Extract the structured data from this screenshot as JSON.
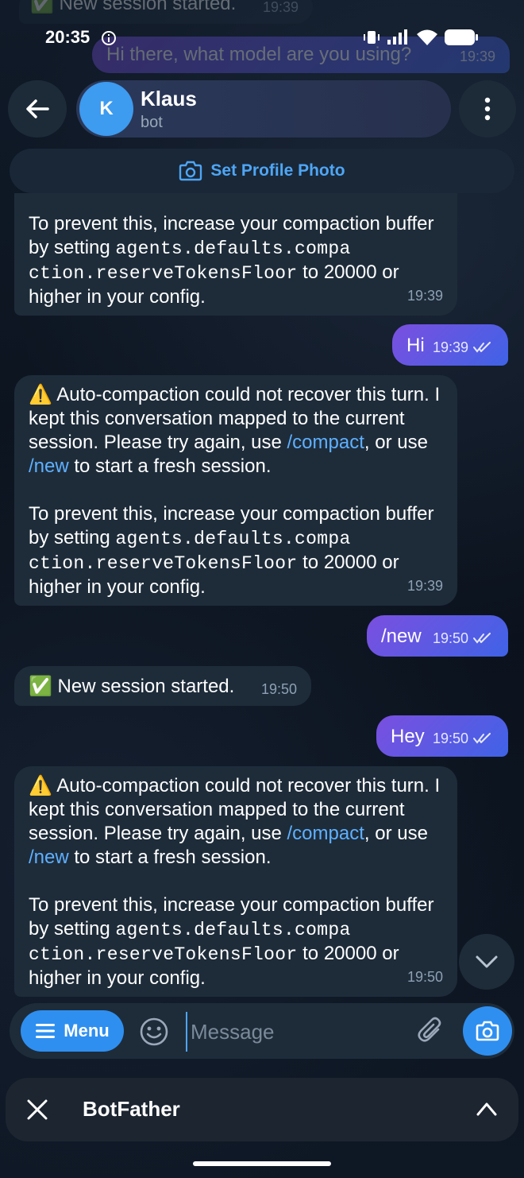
{
  "status_bar": {
    "time": "20:35"
  },
  "ghost_messages": {
    "top_incoming": "✅ New session started.",
    "top_incoming_time": "19:39",
    "top_outgoing": "Hi there, what model are you using?",
    "top_outgoing_time": "19:39"
  },
  "header": {
    "avatar_initial": "K",
    "name": "Klaus",
    "status": "bot",
    "set_profile_photo": "Set Profile Photo"
  },
  "messages": [
    {
      "id": "m1",
      "direction": "in",
      "p2_pre": "To prevent this, increase your compaction buffer by setting ",
      "p2_code1": "agents.defaults.compa",
      "p2_code2": "ction.reserveTokensFloor",
      "p2_post": " to 20000 or higher in your config.",
      "time": "19:39"
    },
    {
      "id": "m2",
      "direction": "out",
      "text": "Hi",
      "time": "19:39"
    },
    {
      "id": "m3",
      "direction": "in",
      "p1_pre": "⚠️ Auto-compaction could not recover this turn. I kept this conversation mapped to the current session. Please try again, use ",
      "p1_link1": "/compact",
      "p1_mid": ", or use ",
      "p1_link2": "/new",
      "p1_post": " to start a fresh session.",
      "p2_pre": "To prevent this, increase your compaction buffer by setting ",
      "p2_code1": "agents.defaults.compa",
      "p2_code2": "ction.reserveTokensFloor",
      "p2_post": " to 20000 or higher in your config.",
      "time": "19:39"
    },
    {
      "id": "m4",
      "direction": "out",
      "text": "/new",
      "time": "19:50"
    },
    {
      "id": "m5",
      "direction": "in",
      "text": "✅ New session started.",
      "time": "19:50"
    },
    {
      "id": "m6",
      "direction": "out",
      "text": "Hey",
      "time": "19:50"
    },
    {
      "id": "m7",
      "direction": "in",
      "p1_pre": "⚠️ Auto-compaction could not recover this turn. I kept this conversation mapped to the current session. Please try again, use ",
      "p1_link1": "/compact",
      "p1_mid": ", or use ",
      "p1_link2": "/new",
      "p1_post": " to start a fresh session.",
      "p2_pre": "To prevent this, increase your compaction buffer by setting ",
      "p2_code1": "agents.defaults.compa",
      "p2_code2": "ction.reserveTokensFloor",
      "p2_post": " to 20000 or higher in your config.",
      "time": "19:50"
    }
  ],
  "composer": {
    "menu_label": "Menu",
    "placeholder": "Message"
  },
  "bottom_panel": {
    "title": "BotFather"
  },
  "colors": {
    "accent": "#2e8ff0",
    "link": "#5eb0ff",
    "incoming_bubble": "#1e2c3a",
    "outgoing_start": "#7b4fe0",
    "outgoing_end": "#3f63e6"
  }
}
